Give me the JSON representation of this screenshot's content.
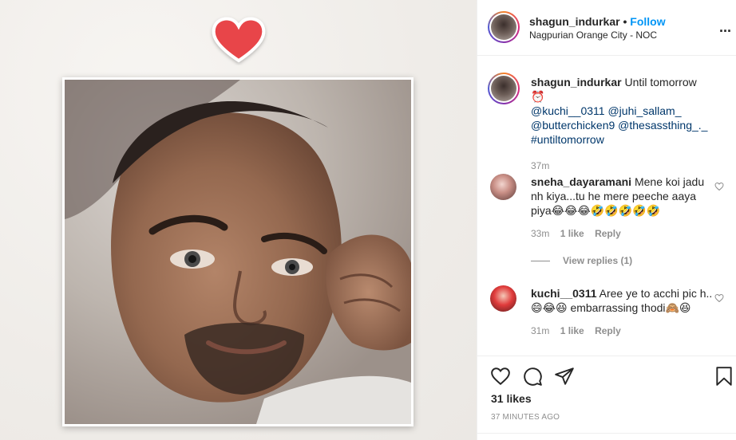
{
  "post": {
    "username": "shagun_indurkar",
    "separator": "•",
    "follow_label": "Follow",
    "location": "Nagpurian Orange City - NOC",
    "more_label": "..."
  },
  "caption": {
    "username": "shagun_indurkar",
    "text": "Until tomorrow ⏰",
    "mentions": [
      "@kuchi__0311",
      "@juhi_sallam_",
      "@butterchicken9",
      "@thesassthing_._",
      "#untiltomorrow"
    ],
    "time": "37m"
  },
  "comments": [
    {
      "username": "sneha_dayaramani",
      "text": "Mene koi jadu nh kiya...tu he mere peeche aaya piya😂😂😂🤣🤣🤣🤣🤣",
      "time": "33m",
      "likes": "1 like",
      "reply_label": "Reply",
      "view_replies": "View replies (1)"
    },
    {
      "username": "kuchi__0311",
      "text": "Aree ye to acchi pic h..😄😂😆 embarrassing thodi🙈😆",
      "time": "31m",
      "likes": "1 like",
      "reply_label": "Reply"
    }
  ],
  "footer": {
    "likes": "31 likes",
    "timeago": "37 MINUTES AGO"
  },
  "icons": {
    "heart_sticker": "heart-icon",
    "like": "heart-outline-icon",
    "comment": "comment-icon",
    "share": "paper-plane-icon",
    "save": "bookmark-icon"
  },
  "colors": {
    "follow": "#0095f6",
    "mention": "#00376b",
    "heart_sticker": "#e53935",
    "muted": "#8e8e8e"
  }
}
